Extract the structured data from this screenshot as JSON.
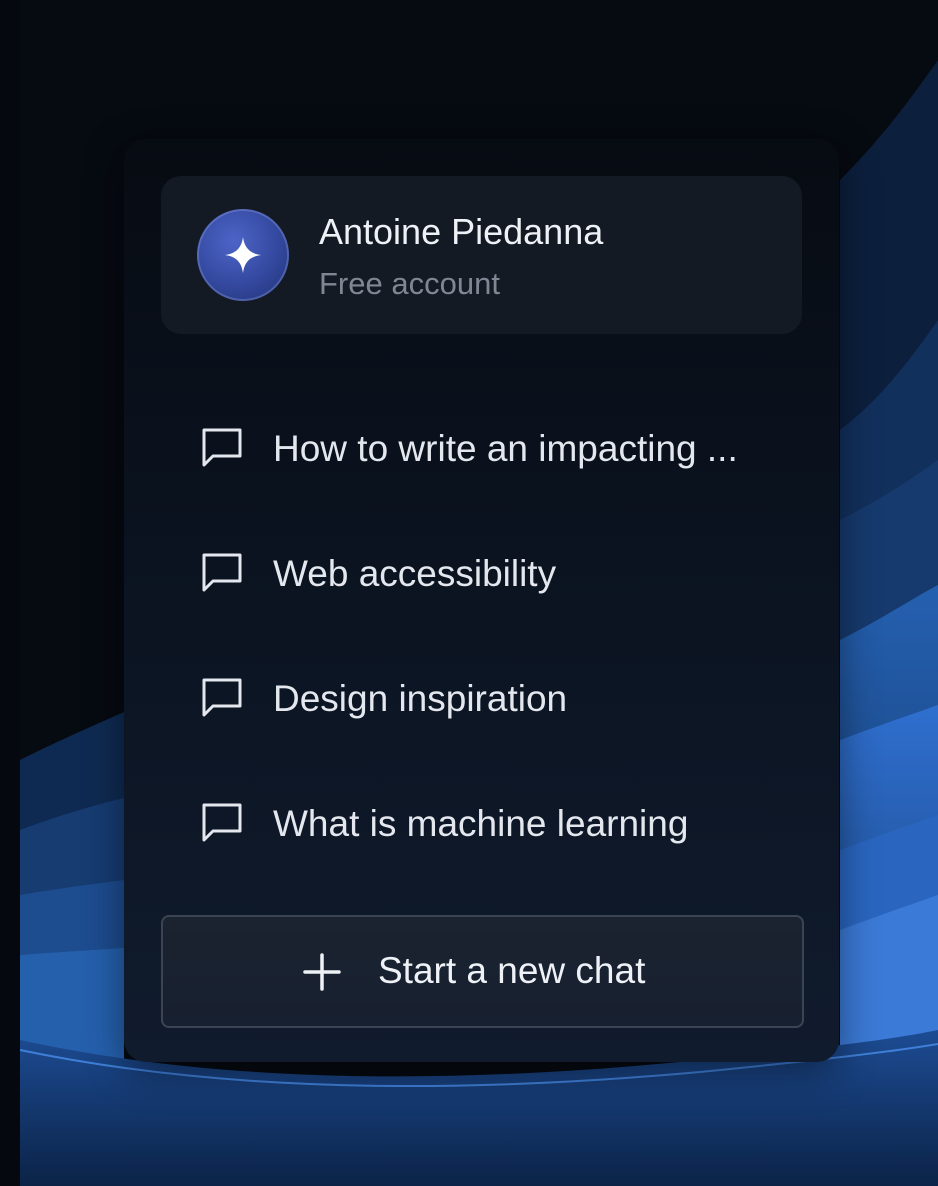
{
  "profile": {
    "name": "Antoine Piedanna",
    "account_type": "Free account",
    "avatar_icon": "sparkle-icon"
  },
  "chats": [
    {
      "label": "How to write an impacting ...",
      "icon": "chat-bubble-icon"
    },
    {
      "label": "Web accessibility",
      "icon": "chat-bubble-icon"
    },
    {
      "label": "Design inspiration",
      "icon": "chat-bubble-icon"
    },
    {
      "label": "What is machine learning",
      "icon": "chat-bubble-icon"
    }
  ],
  "new_chat": {
    "label": "Start a new chat",
    "icon": "plus-icon"
  },
  "colors": {
    "background": "#060a11",
    "wave_accent": "#2f6fcf",
    "avatar": "#3b51ad",
    "text_primary": "#eef1f6",
    "text_secondary": "#7f8794"
  }
}
